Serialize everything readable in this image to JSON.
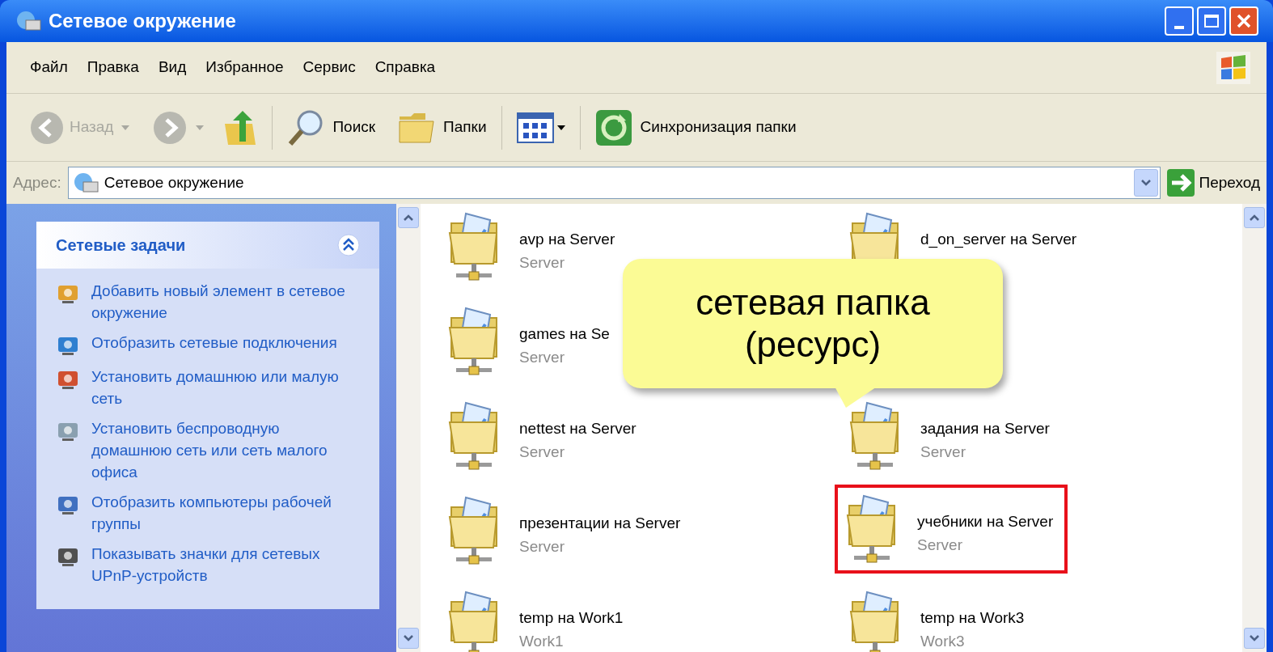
{
  "window": {
    "title": "Сетевое окружение"
  },
  "menu": [
    "Файл",
    "Правка",
    "Вид",
    "Избранное",
    "Сервис",
    "Справка"
  ],
  "toolbar": {
    "back": {
      "label": "Назад",
      "disabled": true
    },
    "search": "Поиск",
    "folders": "Папки",
    "sync": "Синхронизация папки"
  },
  "address": {
    "label": "Адрес:",
    "value": "Сетевое окружение",
    "go": "Переход"
  },
  "tasks": {
    "title": "Сетевые задачи",
    "expanded": true,
    "items": [
      {
        "label": "Добавить новый элемент в сетевое окружение"
      },
      {
        "label": "Отобразить сетевые подключения"
      },
      {
        "label": "Установить домашнюю или малую сеть"
      },
      {
        "label": "Установить беспроводную домашнюю сеть или сеть малого офиса"
      },
      {
        "label": "Отобразить компьютеры рабочей группы"
      },
      {
        "label": "Показывать значки для сетевых UPnP-устройств"
      }
    ]
  },
  "items": [
    {
      "name": "avp на Server",
      "host": "Server",
      "highlighted": false
    },
    {
      "name": "d_on_server на Server",
      "highlighted": false
    },
    {
      "name": "games на Se",
      "host": "Server",
      "highlighted": false
    },
    {
      "name": "nettest на Server",
      "host": "Server",
      "highlighted": false
    },
    {
      "name": "задания на Server",
      "host": "Server",
      "highlighted": false
    },
    {
      "name": "презентации на Server",
      "host": "Server",
      "highlighted": false
    },
    {
      "name": "учебники на Server",
      "host": "Server",
      "highlighted": true
    },
    {
      "name": "temp на Work1",
      "host": "Work1",
      "highlighted": false
    },
    {
      "name": "temp на Work3",
      "host": "Work3",
      "highlighted": false
    }
  ],
  "callout": {
    "lines": [
      "сетевая папка",
      "(ресурс)"
    ]
  }
}
